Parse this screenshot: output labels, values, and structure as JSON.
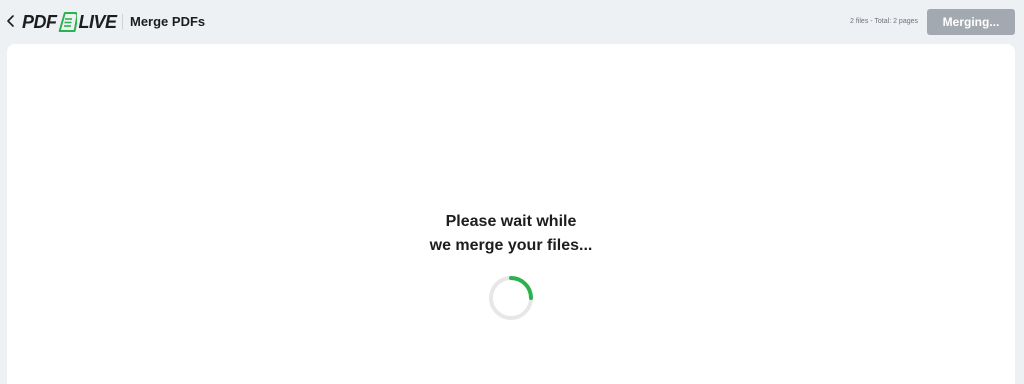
{
  "header": {
    "back_icon": "chevron-left-icon",
    "logo_left": "PDF",
    "logo_right": "LIVE",
    "logo_icon": "document-icon",
    "tool_title": "Merge PDFs",
    "file_info": "2 files - Total: 2 pages",
    "merge_button_label": "Merging..."
  },
  "main": {
    "wait_line1": "Please wait while",
    "wait_line2": "we merge your files...",
    "spinner_icon": "loading-spinner-icon",
    "spinner_progress": 0.25
  },
  "colors": {
    "brand_green": "#2bb24c",
    "spinner_track": "#e6e7e9",
    "button_disabled": "#a3a9b0",
    "background": "#eef1f4"
  }
}
